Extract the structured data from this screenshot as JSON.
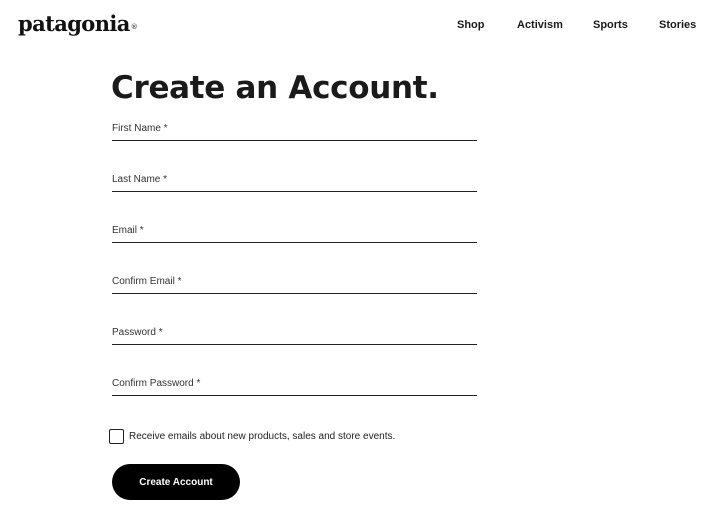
{
  "header": {
    "logo_text": "patagonia",
    "logo_mark": "®",
    "nav": {
      "shop": "Shop",
      "activism": "Activism",
      "sports": "Sports",
      "stories": "Stories"
    }
  },
  "form": {
    "title": "Create an Account.",
    "fields": {
      "first_name": {
        "label": "First Name *",
        "value": ""
      },
      "last_name": {
        "label": "Last Name *",
        "value": ""
      },
      "email": {
        "label": "Email *",
        "value": ""
      },
      "confirm_email": {
        "label": "Confirm Email *",
        "value": ""
      },
      "password": {
        "label": "Password *",
        "value": ""
      },
      "confirm_password": {
        "label": "Confirm Password *",
        "value": ""
      }
    },
    "newsletter": {
      "label": "Receive emails about new products, sales and store events.",
      "checked": false
    },
    "submit_label": "Create Account"
  }
}
